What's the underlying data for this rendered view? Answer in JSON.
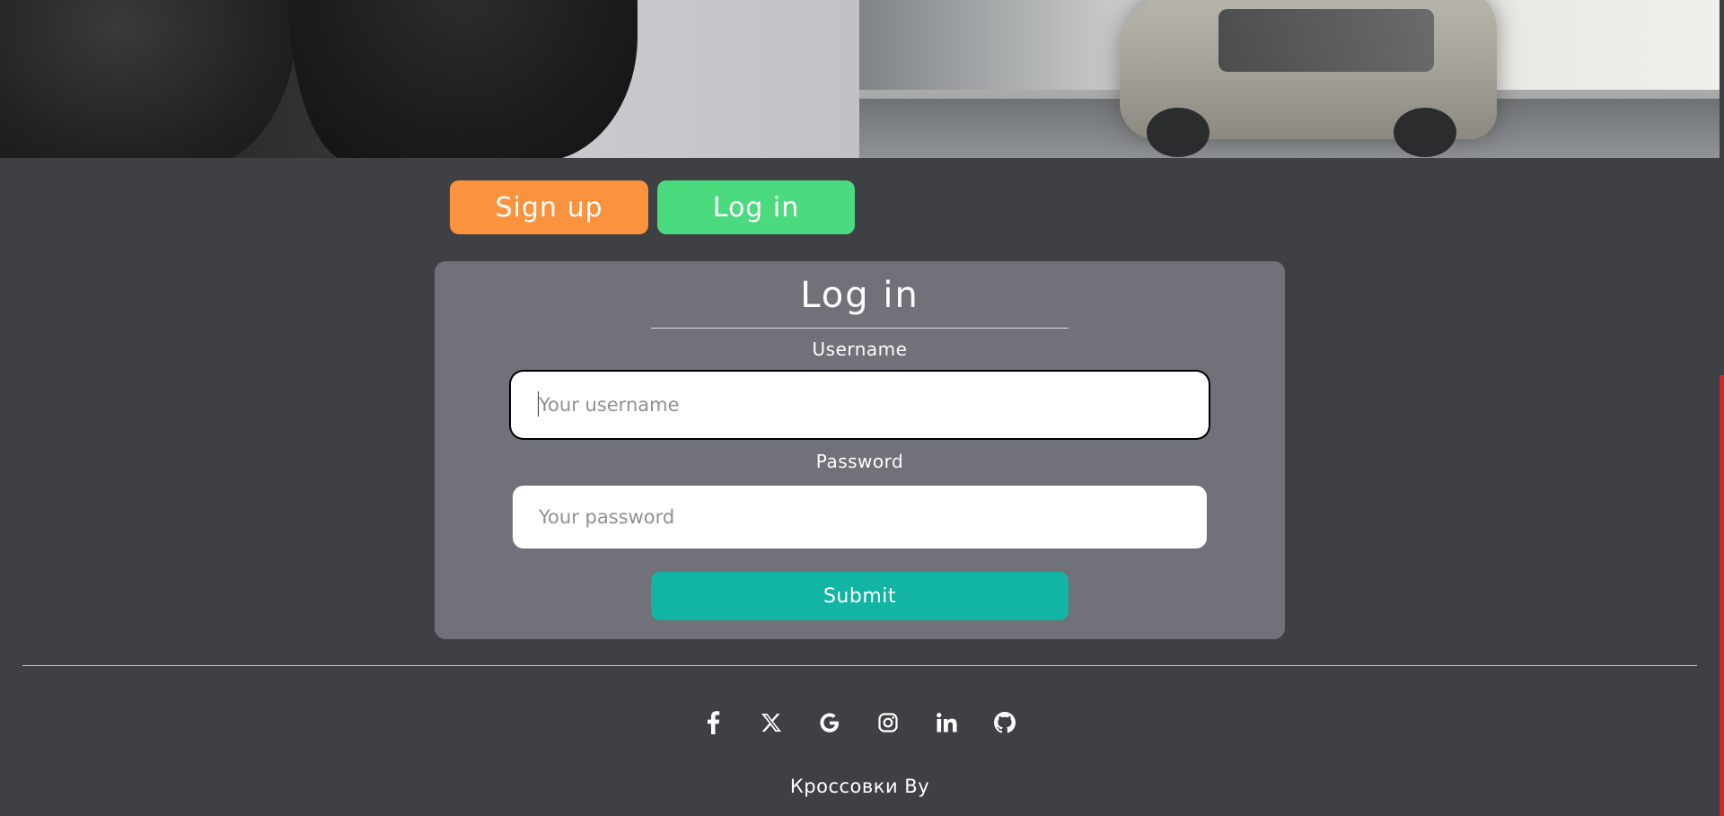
{
  "tabs": {
    "signup_label": "Sign up",
    "login_label": "Log in"
  },
  "form": {
    "title": "Log in",
    "username_label": "Username",
    "username_placeholder": "Your username",
    "password_label": "Password",
    "password_placeholder": "Your password",
    "submit_label": "Submit"
  },
  "footer": {
    "social_icons": [
      "facebook-icon",
      "x-twitter-icon",
      "google-icon",
      "instagram-icon",
      "linkedin-icon",
      "github-icon"
    ],
    "brand": "Кроссовки By"
  },
  "colors": {
    "background": "#3f4044",
    "card": "#707179",
    "signup": "#fa923e",
    "login": "#4bdb7e",
    "submit": "#12b5a4",
    "scroll_thumb": "#d1252b"
  }
}
